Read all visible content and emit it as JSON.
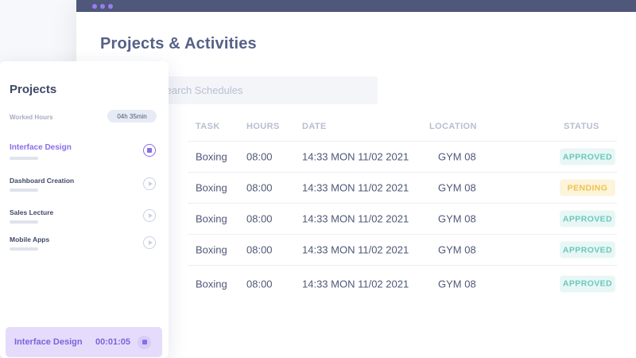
{
  "window": {
    "page_title": "Projects & Activities",
    "search_placeholder": "Search Schedules"
  },
  "table": {
    "headers": {
      "task": "TASK",
      "hours": "HOURS",
      "date": "DATE",
      "location": "LOCATION",
      "status": "STATUS"
    },
    "rows": [
      {
        "task": "Boxing",
        "hours": "08:00",
        "date": "14:33 MON 11/02 2021",
        "location": "GYM 08",
        "status": "APPROVED"
      },
      {
        "task": "Boxing",
        "hours": "08:00",
        "date": "14:33 MON 11/02 2021",
        "location": "GYM 08",
        "status": "PENDING"
      },
      {
        "task": "Boxing",
        "hours": "08:00",
        "date": "14:33 MON 11/02 2021",
        "location": "GYM 08",
        "status": "APPROVED"
      },
      {
        "task": "Boxing",
        "hours": "08:00",
        "date": "14:33 MON 11/02 2021",
        "location": "GYM 08",
        "status": "APPROVED"
      },
      {
        "task": "Boxing",
        "hours": "08:00",
        "date": "14:33 MON 11/02 2021",
        "location": "GYM 08",
        "status": "APPROVED"
      }
    ]
  },
  "sidebar": {
    "title": "Projects",
    "worked_hours_label": "Worked Hours",
    "worked_hours_value": "04h 35min",
    "projects": [
      {
        "label": "Interface Design",
        "active": true,
        "icon": "stop-icon"
      },
      {
        "label": "Dashboard Creation",
        "active": false,
        "icon": "play-icon"
      },
      {
        "label": "Sales Lecture",
        "active": false,
        "icon": "play-icon"
      },
      {
        "label": "Mobile Apps",
        "active": false,
        "icon": "play-icon"
      }
    ]
  },
  "timer": {
    "label": "Interface Design",
    "time": "00:01:05"
  },
  "colors": {
    "titlebar": "#4f587a",
    "accent": "#8a6de9",
    "approved": "#68c8be",
    "pending": "#f0c14b"
  }
}
